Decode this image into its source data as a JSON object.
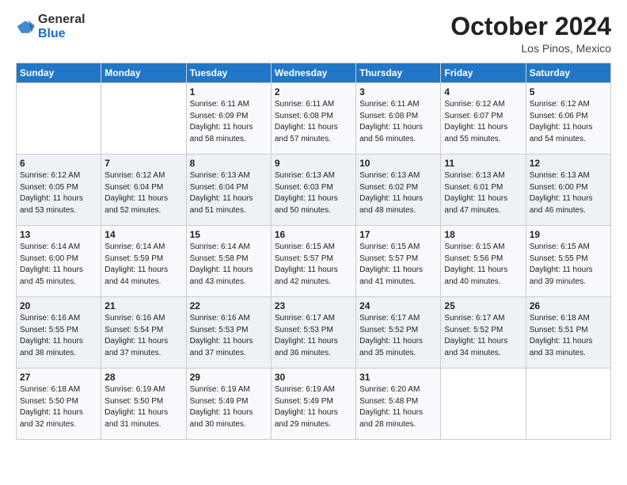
{
  "logo": {
    "general": "General",
    "blue": "Blue"
  },
  "title": {
    "month": "October 2024",
    "location": "Los Pinos, Mexico"
  },
  "weekdays": [
    "Sunday",
    "Monday",
    "Tuesday",
    "Wednesday",
    "Thursday",
    "Friday",
    "Saturday"
  ],
  "weeks": [
    [
      {
        "day": "",
        "info": ""
      },
      {
        "day": "",
        "info": ""
      },
      {
        "day": "1",
        "info": "Sunrise: 6:11 AM\nSunset: 6:09 PM\nDaylight: 11 hours and 58 minutes."
      },
      {
        "day": "2",
        "info": "Sunrise: 6:11 AM\nSunset: 6:08 PM\nDaylight: 11 hours and 57 minutes."
      },
      {
        "day": "3",
        "info": "Sunrise: 6:11 AM\nSunset: 6:08 PM\nDaylight: 11 hours and 56 minutes."
      },
      {
        "day": "4",
        "info": "Sunrise: 6:12 AM\nSunset: 6:07 PM\nDaylight: 11 hours and 55 minutes."
      },
      {
        "day": "5",
        "info": "Sunrise: 6:12 AM\nSunset: 6:06 PM\nDaylight: 11 hours and 54 minutes."
      }
    ],
    [
      {
        "day": "6",
        "info": "Sunrise: 6:12 AM\nSunset: 6:05 PM\nDaylight: 11 hours and 53 minutes."
      },
      {
        "day": "7",
        "info": "Sunrise: 6:12 AM\nSunset: 6:04 PM\nDaylight: 11 hours and 52 minutes."
      },
      {
        "day": "8",
        "info": "Sunrise: 6:13 AM\nSunset: 6:04 PM\nDaylight: 11 hours and 51 minutes."
      },
      {
        "day": "9",
        "info": "Sunrise: 6:13 AM\nSunset: 6:03 PM\nDaylight: 11 hours and 50 minutes."
      },
      {
        "day": "10",
        "info": "Sunrise: 6:13 AM\nSunset: 6:02 PM\nDaylight: 11 hours and 48 minutes."
      },
      {
        "day": "11",
        "info": "Sunrise: 6:13 AM\nSunset: 6:01 PM\nDaylight: 11 hours and 47 minutes."
      },
      {
        "day": "12",
        "info": "Sunrise: 6:13 AM\nSunset: 6:00 PM\nDaylight: 11 hours and 46 minutes."
      }
    ],
    [
      {
        "day": "13",
        "info": "Sunrise: 6:14 AM\nSunset: 6:00 PM\nDaylight: 11 hours and 45 minutes."
      },
      {
        "day": "14",
        "info": "Sunrise: 6:14 AM\nSunset: 5:59 PM\nDaylight: 11 hours and 44 minutes."
      },
      {
        "day": "15",
        "info": "Sunrise: 6:14 AM\nSunset: 5:58 PM\nDaylight: 11 hours and 43 minutes."
      },
      {
        "day": "16",
        "info": "Sunrise: 6:15 AM\nSunset: 5:57 PM\nDaylight: 11 hours and 42 minutes."
      },
      {
        "day": "17",
        "info": "Sunrise: 6:15 AM\nSunset: 5:57 PM\nDaylight: 11 hours and 41 minutes."
      },
      {
        "day": "18",
        "info": "Sunrise: 6:15 AM\nSunset: 5:56 PM\nDaylight: 11 hours and 40 minutes."
      },
      {
        "day": "19",
        "info": "Sunrise: 6:15 AM\nSunset: 5:55 PM\nDaylight: 11 hours and 39 minutes."
      }
    ],
    [
      {
        "day": "20",
        "info": "Sunrise: 6:16 AM\nSunset: 5:55 PM\nDaylight: 11 hours and 38 minutes."
      },
      {
        "day": "21",
        "info": "Sunrise: 6:16 AM\nSunset: 5:54 PM\nDaylight: 11 hours and 37 minutes."
      },
      {
        "day": "22",
        "info": "Sunrise: 6:16 AM\nSunset: 5:53 PM\nDaylight: 11 hours and 37 minutes."
      },
      {
        "day": "23",
        "info": "Sunrise: 6:17 AM\nSunset: 5:53 PM\nDaylight: 11 hours and 36 minutes."
      },
      {
        "day": "24",
        "info": "Sunrise: 6:17 AM\nSunset: 5:52 PM\nDaylight: 11 hours and 35 minutes."
      },
      {
        "day": "25",
        "info": "Sunrise: 6:17 AM\nSunset: 5:52 PM\nDaylight: 11 hours and 34 minutes."
      },
      {
        "day": "26",
        "info": "Sunrise: 6:18 AM\nSunset: 5:51 PM\nDaylight: 11 hours and 33 minutes."
      }
    ],
    [
      {
        "day": "27",
        "info": "Sunrise: 6:18 AM\nSunset: 5:50 PM\nDaylight: 11 hours and 32 minutes."
      },
      {
        "day": "28",
        "info": "Sunrise: 6:19 AM\nSunset: 5:50 PM\nDaylight: 11 hours and 31 minutes."
      },
      {
        "day": "29",
        "info": "Sunrise: 6:19 AM\nSunset: 5:49 PM\nDaylight: 11 hours and 30 minutes."
      },
      {
        "day": "30",
        "info": "Sunrise: 6:19 AM\nSunset: 5:49 PM\nDaylight: 11 hours and 29 minutes."
      },
      {
        "day": "31",
        "info": "Sunrise: 6:20 AM\nSunset: 5:48 PM\nDaylight: 11 hours and 28 minutes."
      },
      {
        "day": "",
        "info": ""
      },
      {
        "day": "",
        "info": ""
      }
    ]
  ]
}
